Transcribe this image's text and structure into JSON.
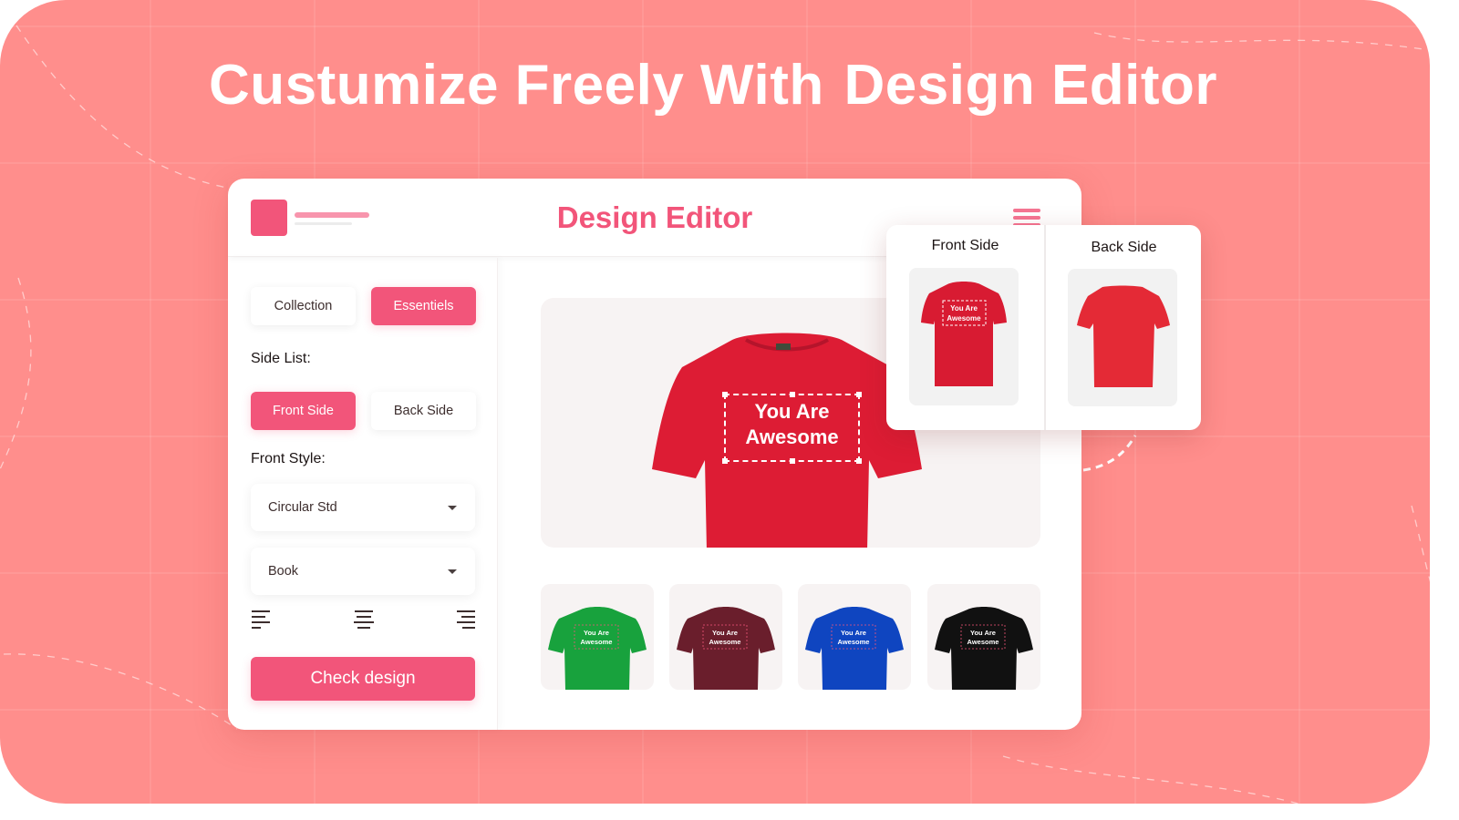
{
  "headline": {
    "prefix": "Custumize Freely With",
    "highlight": "Design Editor"
  },
  "editor": {
    "title": "Design Editor",
    "icons": {
      "logo": "logo-square",
      "menu": "hamburger-menu-icon"
    },
    "sidebar": {
      "tabs": [
        {
          "label": "Collection",
          "active": false
        },
        {
          "label": "Essentiels",
          "active": true
        }
      ],
      "side_list_label": "Side List:",
      "side_buttons": [
        {
          "label": "Front Side",
          "active": true
        },
        {
          "label": "Back Side",
          "active": false
        }
      ],
      "front_style_label": "Front Style:",
      "font_family_select": {
        "value": "Circular Std"
      },
      "font_weight_select": {
        "value": "Book"
      },
      "alignment_options": [
        "align-left",
        "align-center",
        "align-right"
      ],
      "check_button": "Check design"
    },
    "canvas": {
      "shirt_color": "#dd1c34",
      "text_line1": "You Are",
      "text_line2": "Awesome"
    },
    "variants": [
      {
        "color_name": "green",
        "color": "#18a23d",
        "line1": "You Are",
        "line2": "Awesome"
      },
      {
        "color_name": "maroon",
        "color": "#6a1e2c",
        "line1": "You Are",
        "line2": "Awesome"
      },
      {
        "color_name": "blue",
        "color": "#0f45c0",
        "line1": "You Are",
        "line2": "Awesome"
      },
      {
        "color_name": "black",
        "color": "#111111",
        "line1": "You Are",
        "line2": "Awesome"
      }
    ]
  },
  "sides_popup": {
    "front": {
      "title": "Front Side",
      "line1": "You Are",
      "line2": "Awesome",
      "color": "#dd1c34"
    },
    "back": {
      "title": "Back Side",
      "color": "#e42a36"
    }
  },
  "colors": {
    "background": "#ff8e8c",
    "accent": "#f2557a"
  }
}
